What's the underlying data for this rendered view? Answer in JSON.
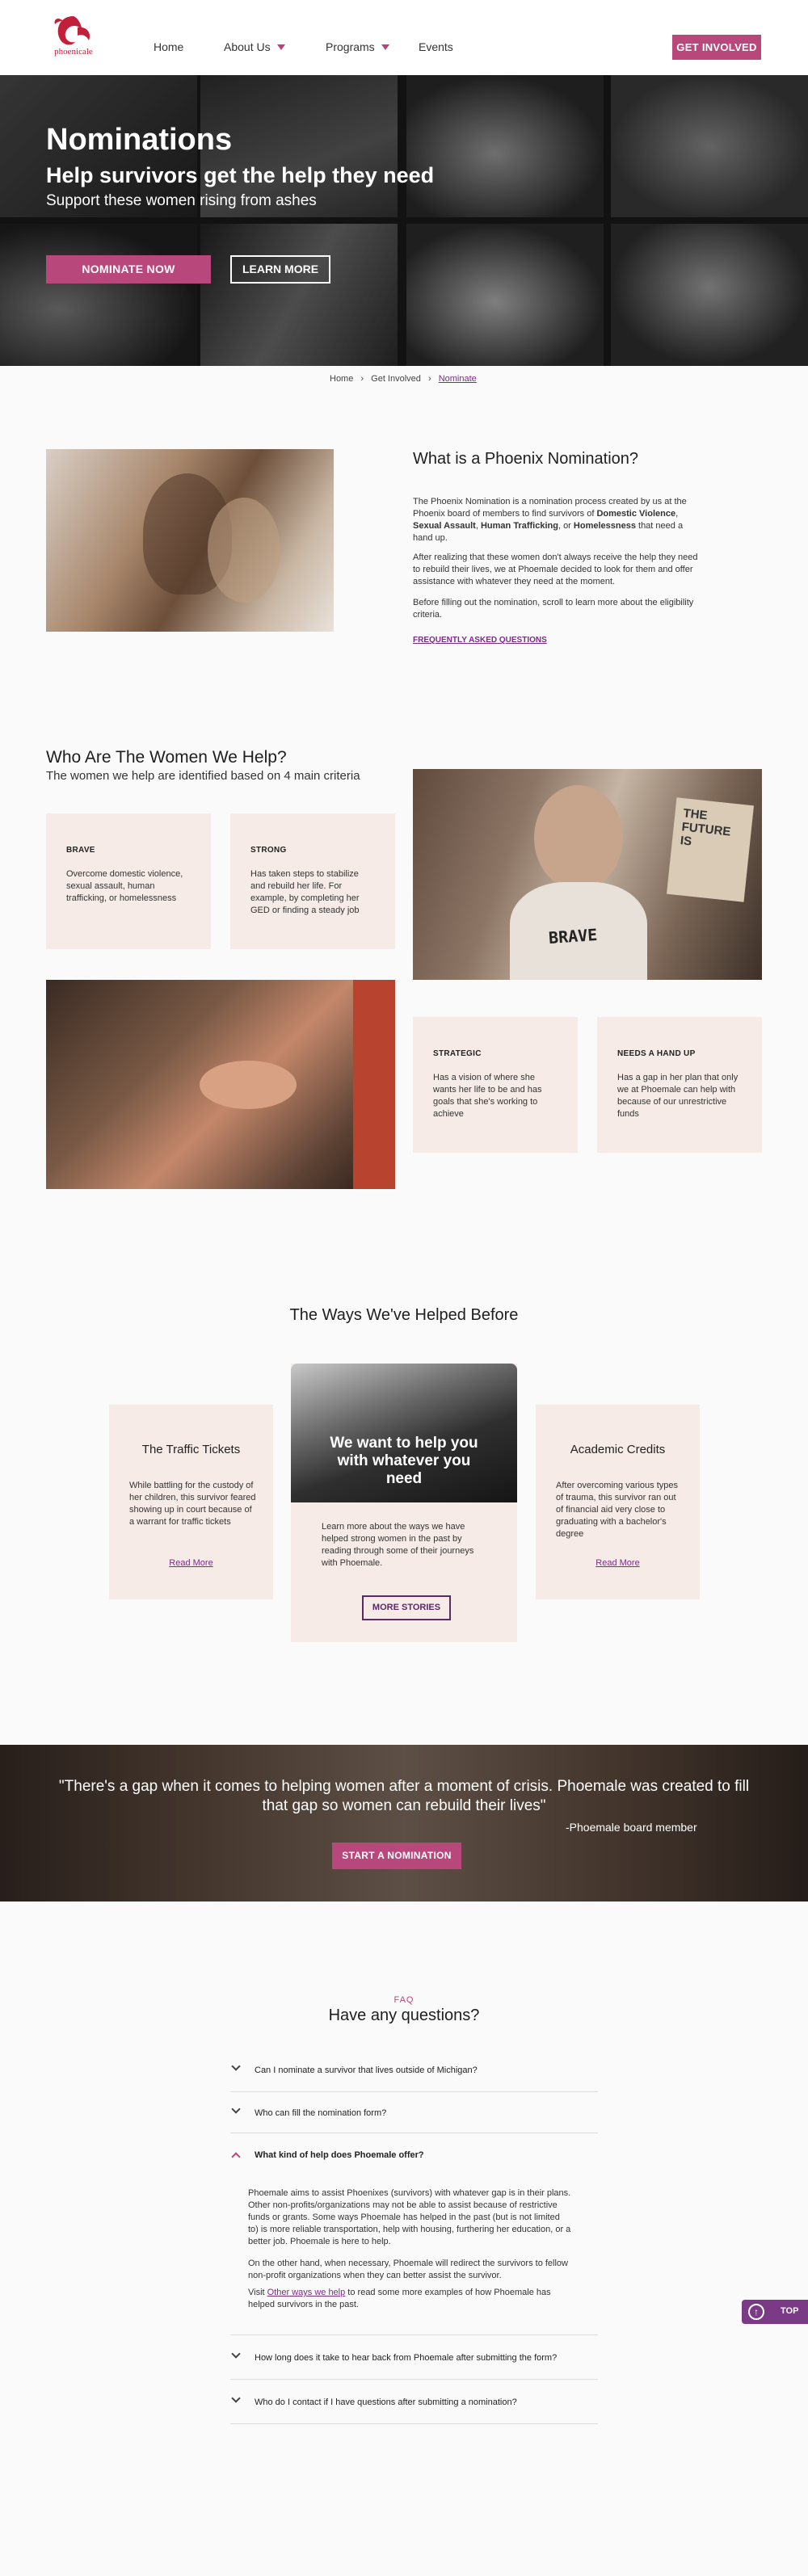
{
  "header": {
    "logo_text": "phoenicale",
    "nav": [
      {
        "label": "Home",
        "has_dropdown": false
      },
      {
        "label": "About Us",
        "has_dropdown": true
      },
      {
        "label": "Programs",
        "has_dropdown": true
      },
      {
        "label": "Events",
        "has_dropdown": false
      }
    ],
    "cta_label": "GET INVOLVED"
  },
  "hero": {
    "title": "Nominations",
    "subtitle": "Help survivors get the help they need",
    "tagline": "Support these women rising from ashes",
    "primary_button": "NOMINATE NOW",
    "secondary_button": "LEARN MORE"
  },
  "breadcrumb": {
    "items": [
      "Home",
      "Get Involved",
      "Nominate"
    ]
  },
  "intro": {
    "heading": "What is a Phoenix Nomination?",
    "p1_start": "The Phoenix Nomination is a nomination process created by us at the Phoenix board of members to find survivors of ",
    "p1_bold1": "Domestic Violence",
    "p1_sep1": ", ",
    "p1_bold2": "Sexual Assault",
    "p1_sep2": ", ",
    "p1_bold3": "Human Trafficking",
    "p1_sep3": ", or ",
    "p1_bold4": "Homelessness",
    "p1_end": " that need a hand up.",
    "p2": "After realizing that these women don't always receive the help they need to rebuild their lives, we at Phoemale decided to look for them and offer assistance with whatever they need at the moment.",
    "p3": "Before filling out the nomination, scroll to learn more about the eligibility criteria.",
    "faq_link": "FREQUENTLY ASKED QUESTIONS"
  },
  "criteria": {
    "heading": "Who Are The Women We  Help?",
    "subheading": "The women we help are identified based on 4 main criteria",
    "cards": [
      {
        "title": "BRAVE",
        "text": "Overcome domestic violence, sexual assault, human trafficking, or homelessness"
      },
      {
        "title": "STRONG",
        "text": "Has taken steps to stabilize and rebuild her life. For example, by completing her GED or finding a steady job"
      },
      {
        "title": "STRATEGIC",
        "text": "Has a vision of where she wants her life to be and has goals that she's working to achieve"
      },
      {
        "title": "NEEDS A HAND UP",
        "text": "Has a gap in her plan that only we at Phoemale can help with because of our unrestrictive funds"
      }
    ],
    "sign_words": [
      "BRAVE",
      "THE FUTURE IS"
    ]
  },
  "stories": {
    "heading": "The Ways We've Helped Before",
    "left": {
      "title": "The Traffic Tickets",
      "text": "While battling for the custody of her children, this survivor feared showing up in court because of a warrant  for traffic tickets",
      "link": "Read More"
    },
    "center": {
      "overlay": "We want to help you with whatever you need",
      "text": "Learn more about the ways we have helped strong women in the past by reading through some of their journeys with Phoemale.",
      "button": "MORE STORIES"
    },
    "right": {
      "title": "Academic Credits",
      "text": "After overcoming various types of trauma, this survivor ran out of financial aid very close to graduating with a bachelor's degree",
      "link": "Read More"
    }
  },
  "quote": {
    "text": "\"There's a gap when it comes to helping women after a moment of crisis. Phoemale was created to fill that gap so women can rebuild their lives\"",
    "attribution": "-Phoemale board member",
    "button": "START A NOMINATION"
  },
  "faq": {
    "eyebrow": "FAQ",
    "heading": "Have any questions?",
    "items": [
      {
        "q": "Can I nominate a survivor that lives outside of Michigan?",
        "open": false
      },
      {
        "q": "Who can fill the nomination form?",
        "open": false
      },
      {
        "q": "What kind of help does Phoemale offer?",
        "open": true
      },
      {
        "q": "How long does it take to hear back from Phoemale after submitting the form?",
        "open": false
      },
      {
        "q": "Who do I contact if I have questions after submitting a nomination?",
        "open": false
      }
    ],
    "answer_p1": "Phoemale aims to assist Phoenixes (survivors) with whatever gap is in their plans. Other non-profits/organizations may not be able to assist because of restrictive funds or grants. Some ways Phoemale has helped in the past (but is not limited to) is more reliable transportation, help with housing, furthering her education, or a better job. Phoemale is here to help.",
    "answer_p2": "On the other hand, when necessary, Phoemale will redirect the survivors to fellow non-profit organizations when they can better assist the survivor.",
    "answer_p3_start": "Visit ",
    "answer_p3_link": "Other ways we help",
    "answer_p3_end": " to read some more examples of how Phoemale has helped survivors in the past.",
    "top_button": "TOP"
  },
  "colors": {
    "accent": "#b8477c",
    "card_bg": "#f6ebe7",
    "link": "#7b2b86"
  }
}
